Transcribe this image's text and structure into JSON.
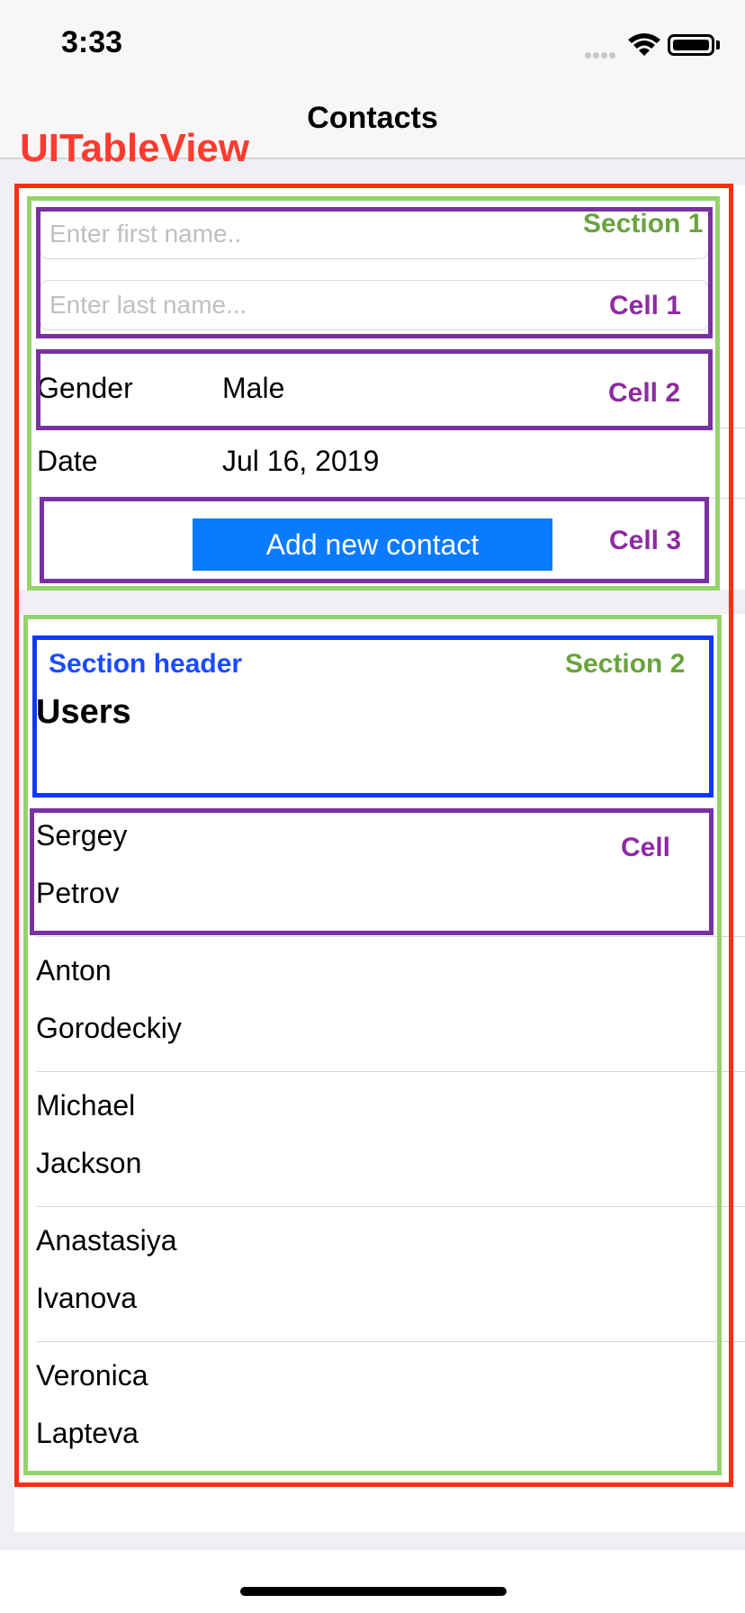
{
  "status_bar": {
    "time": "3:33"
  },
  "nav": {
    "title": "Contacts"
  },
  "annotations": {
    "tableview": "UITableView",
    "section1": "Section 1",
    "cell1": "Cell 1",
    "cell2": "Cell 2",
    "cell3": "Cell 3",
    "section_header": "Section header",
    "section2": "Section 2",
    "cell": "Cell"
  },
  "form": {
    "first_name_placeholder": "Enter first name..",
    "last_name_placeholder": "Enter last name...",
    "gender_label": "Gender",
    "gender_value": "Male",
    "date_label": "Date",
    "date_value": "Jul 16, 2019",
    "add_button": "Add new contact"
  },
  "users_section": {
    "title": "Users",
    "contacts": [
      {
        "first": "Sergey",
        "last": "Petrov"
      },
      {
        "first": "Anton",
        "last": "Gorodeckiy"
      },
      {
        "first": "Michael",
        "last": "Jackson"
      },
      {
        "first": "Anastasiya",
        "last": "Ivanova"
      },
      {
        "first": "Veronica",
        "last": "Lapteva"
      }
    ]
  },
  "colors": {
    "tableview_box": "#ff2d13",
    "section_box": "#93d46a",
    "cell_box": "#7a31a2",
    "header_box": "#1237ff",
    "button": "#0a7bff"
  }
}
